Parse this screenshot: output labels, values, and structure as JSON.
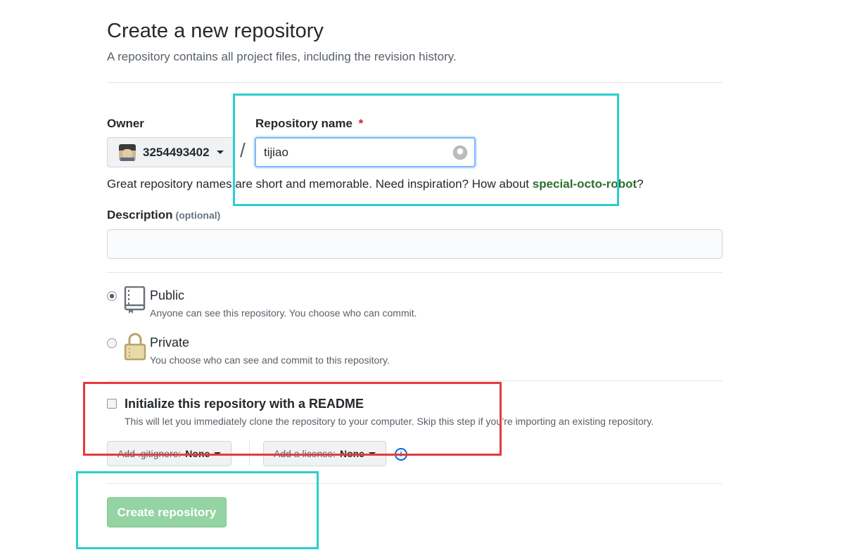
{
  "header": {
    "title": "Create a new repository",
    "subtitle": "A repository contains all project files, including the revision history."
  },
  "owner": {
    "label": "Owner",
    "name": "3254493402"
  },
  "repo_name": {
    "label": "Repository name",
    "required_mark": "*",
    "value": "tijiao",
    "separator": "/"
  },
  "hint": {
    "text": "Great repository names are short and memorable. Need inspiration? How about ",
    "suggestion": "special-octo-robot",
    "end": "?"
  },
  "description": {
    "label": "Description",
    "optional": "(optional)",
    "value": ""
  },
  "visibility": {
    "public": {
      "title": "Public",
      "desc": "Anyone can see this repository. You choose who can commit.",
      "checked": true
    },
    "private": {
      "title": "Private",
      "desc": "You choose who can see and commit to this repository.",
      "checked": false
    }
  },
  "readme": {
    "title": "Initialize this repository with a README",
    "desc": "This will let you immediately clone the repository to your computer. Skip this step if you’re importing an existing repository.",
    "checked": false
  },
  "gitignore": {
    "prefix": "Add .gitignore:",
    "value": "None"
  },
  "license": {
    "prefix": "Add a license:",
    "value": "None"
  },
  "info_icon": "i",
  "submit": {
    "label": "Create repository"
  },
  "colors": {
    "highlight_cyan": "#2bcfcf",
    "highlight_red": "#e8383d",
    "create_button": "#94d3a2",
    "suggestion": "#2c6f2e"
  }
}
